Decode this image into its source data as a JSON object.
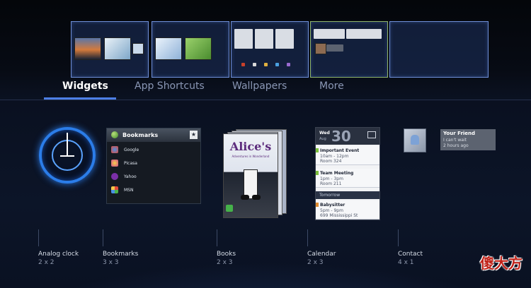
{
  "tabs": [
    {
      "label": "Widgets",
      "active": true
    },
    {
      "label": "App Shortcuts",
      "active": false
    },
    {
      "label": "Wallpapers",
      "active": false
    },
    {
      "label": "More",
      "active": false
    }
  ],
  "screens_count": 5,
  "widgets": {
    "analog_clock": {
      "name": "Analog clock",
      "size": "2 x 2"
    },
    "bookmarks": {
      "name": "Bookmarks",
      "size": "3 x 3",
      "header": "Bookmarks",
      "items": [
        "Google",
        "Picasa",
        "Yahoo",
        "MSN"
      ]
    },
    "books": {
      "name": "Books",
      "size": "2 x 3",
      "cover_title": "Alice's",
      "cover_sub": "Adventures in Wonderland"
    },
    "calendar": {
      "name": "Calendar",
      "size": "2 x 3",
      "day": "Wed",
      "month": "Aug",
      "date": "30",
      "events": [
        {
          "title": "Important Event",
          "time": "10am - 12pm",
          "place": "Room 324",
          "color": "#7bbf3a"
        },
        {
          "title": "Team Meeting",
          "time": "1pm - 3pm",
          "place": "Room 211",
          "color": "#7bbf3a"
        }
      ],
      "tomorrow_label": "Tomorrow",
      "next_event": {
        "title": "Babysitter",
        "time": "5pm - 9pm",
        "place": "699 Mississippi St",
        "color": "#e08a2c"
      }
    },
    "contact": {
      "name": "Contact",
      "size": "4 x 1",
      "friend_name": "Your Friend",
      "status": "I can't wait",
      "ago": "2 hours ago"
    }
  },
  "watermark": "傻大方"
}
